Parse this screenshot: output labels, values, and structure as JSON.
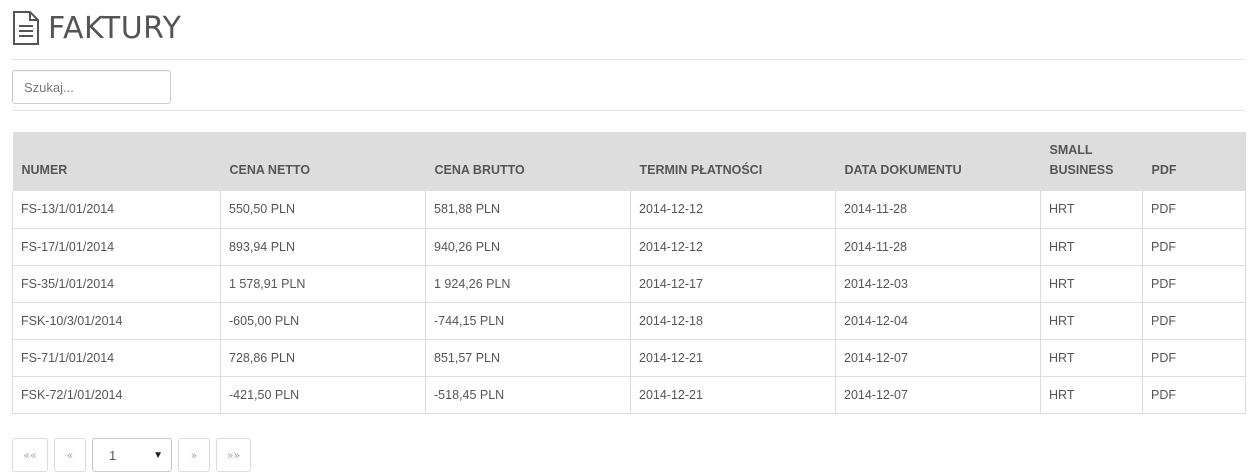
{
  "header": {
    "title": "FAKTURY",
    "icon": "document-icon"
  },
  "search": {
    "placeholder": "Szukaj..."
  },
  "table": {
    "columns": [
      "NUMER",
      "CENA NETTO",
      "CENA BRUTTO",
      "TERMIN PŁATNOŚCI",
      "DATA DOKUMENTU",
      "SMALL BUSINESS",
      "PDF"
    ],
    "rows": [
      [
        "FS-13/1/01/2014",
        "550,50 PLN",
        "581,88 PLN",
        "2014-12-12",
        "2014-11-28",
        "HRT",
        "PDF"
      ],
      [
        "FS-17/1/01/2014",
        "893,94 PLN",
        "940,26 PLN",
        "2014-12-12",
        "2014-11-28",
        "HRT",
        "PDF"
      ],
      [
        "FS-35/1/01/2014",
        "1 578,91 PLN",
        "1 924,26 PLN",
        "2014-12-17",
        "2014-12-03",
        "HRT",
        "PDF"
      ],
      [
        "FSK-10/3/01/2014",
        "-605,00 PLN",
        "-744,15 PLN",
        "2014-12-18",
        "2014-12-04",
        "HRT",
        "PDF"
      ],
      [
        "FS-71/1/01/2014",
        "728,86 PLN",
        "851,57 PLN",
        "2014-12-21",
        "2014-12-07",
        "HRT",
        "PDF"
      ],
      [
        "FSK-72/1/01/2014",
        "-421,50 PLN",
        "-518,45 PLN",
        "2014-12-21",
        "2014-12-07",
        "HRT",
        "PDF"
      ]
    ]
  },
  "pagination": {
    "first": "««",
    "prev": "«",
    "page": "1",
    "next": "»",
    "last": "»»"
  },
  "colors": {
    "header_bg": "#dddddd",
    "text": "#555555",
    "border": "#dddddd"
  }
}
